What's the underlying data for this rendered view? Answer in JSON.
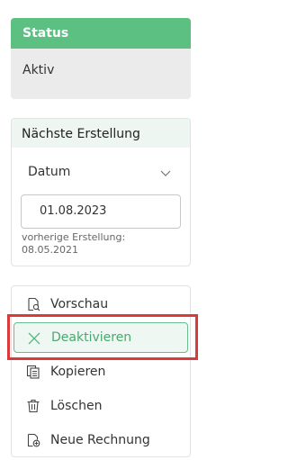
{
  "status": {
    "header": "Status",
    "value": "Aktiv",
    "header_color": "#5cc083"
  },
  "next_creation": {
    "header": "Nächste Erstellung",
    "select_value": "Datum",
    "date_value": "01.08.2023",
    "prev_label": "vorherige Erstellung:",
    "prev_date": "08.05.2021"
  },
  "actions": [
    {
      "label": "Vorschau",
      "icon": "preview-icon"
    },
    {
      "label": "Deaktivieren",
      "icon": "close-icon"
    },
    {
      "label": "Kopieren",
      "icon": "copy-icon"
    },
    {
      "label": "Löschen",
      "icon": "trash-icon"
    },
    {
      "label": "Neue Rechnung",
      "icon": "new-invoice-icon"
    }
  ],
  "colors": {
    "accent": "#5cc083",
    "highlight": "#d93a3a"
  }
}
